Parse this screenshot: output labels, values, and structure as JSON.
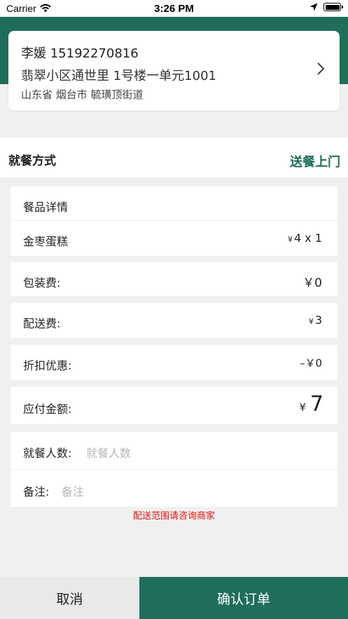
{
  "status_bar": {
    "carrier": "Carrier",
    "time": "3:26 PM"
  },
  "address": {
    "name_phone": "李媛 15192270816",
    "street": "翡翠小区通世里 1号楼一单元1001",
    "region": "山东省 烟台市 毓璜顶街道"
  },
  "dining": {
    "label": "就餐方式",
    "value": "送餐上门"
  },
  "details": {
    "header": "餐品详情",
    "items": [
      {
        "name": "金枣蛋糕",
        "price": "4",
        "qty": "x 1"
      }
    ]
  },
  "fees": {
    "packing_label": "包装费:",
    "packing_value": "￥0",
    "delivery_label": "配送费:",
    "delivery_value": "3",
    "discount_label": "折扣优惠:",
    "discount_value": "–￥0",
    "total_label": "应付金额:",
    "total_value": "7"
  },
  "form": {
    "diners_label": "就餐人数:",
    "diners_placeholder": "就餐人数",
    "remark_label": "备注:",
    "remark_placeholder": "备注"
  },
  "notice": "配送范围请咨询商家",
  "actions": {
    "cancel": "取消",
    "confirm": "确认订单"
  },
  "colors": {
    "accent": "#1f6e5b",
    "price_red": "#e01010"
  },
  "currency_symbol": "¥"
}
